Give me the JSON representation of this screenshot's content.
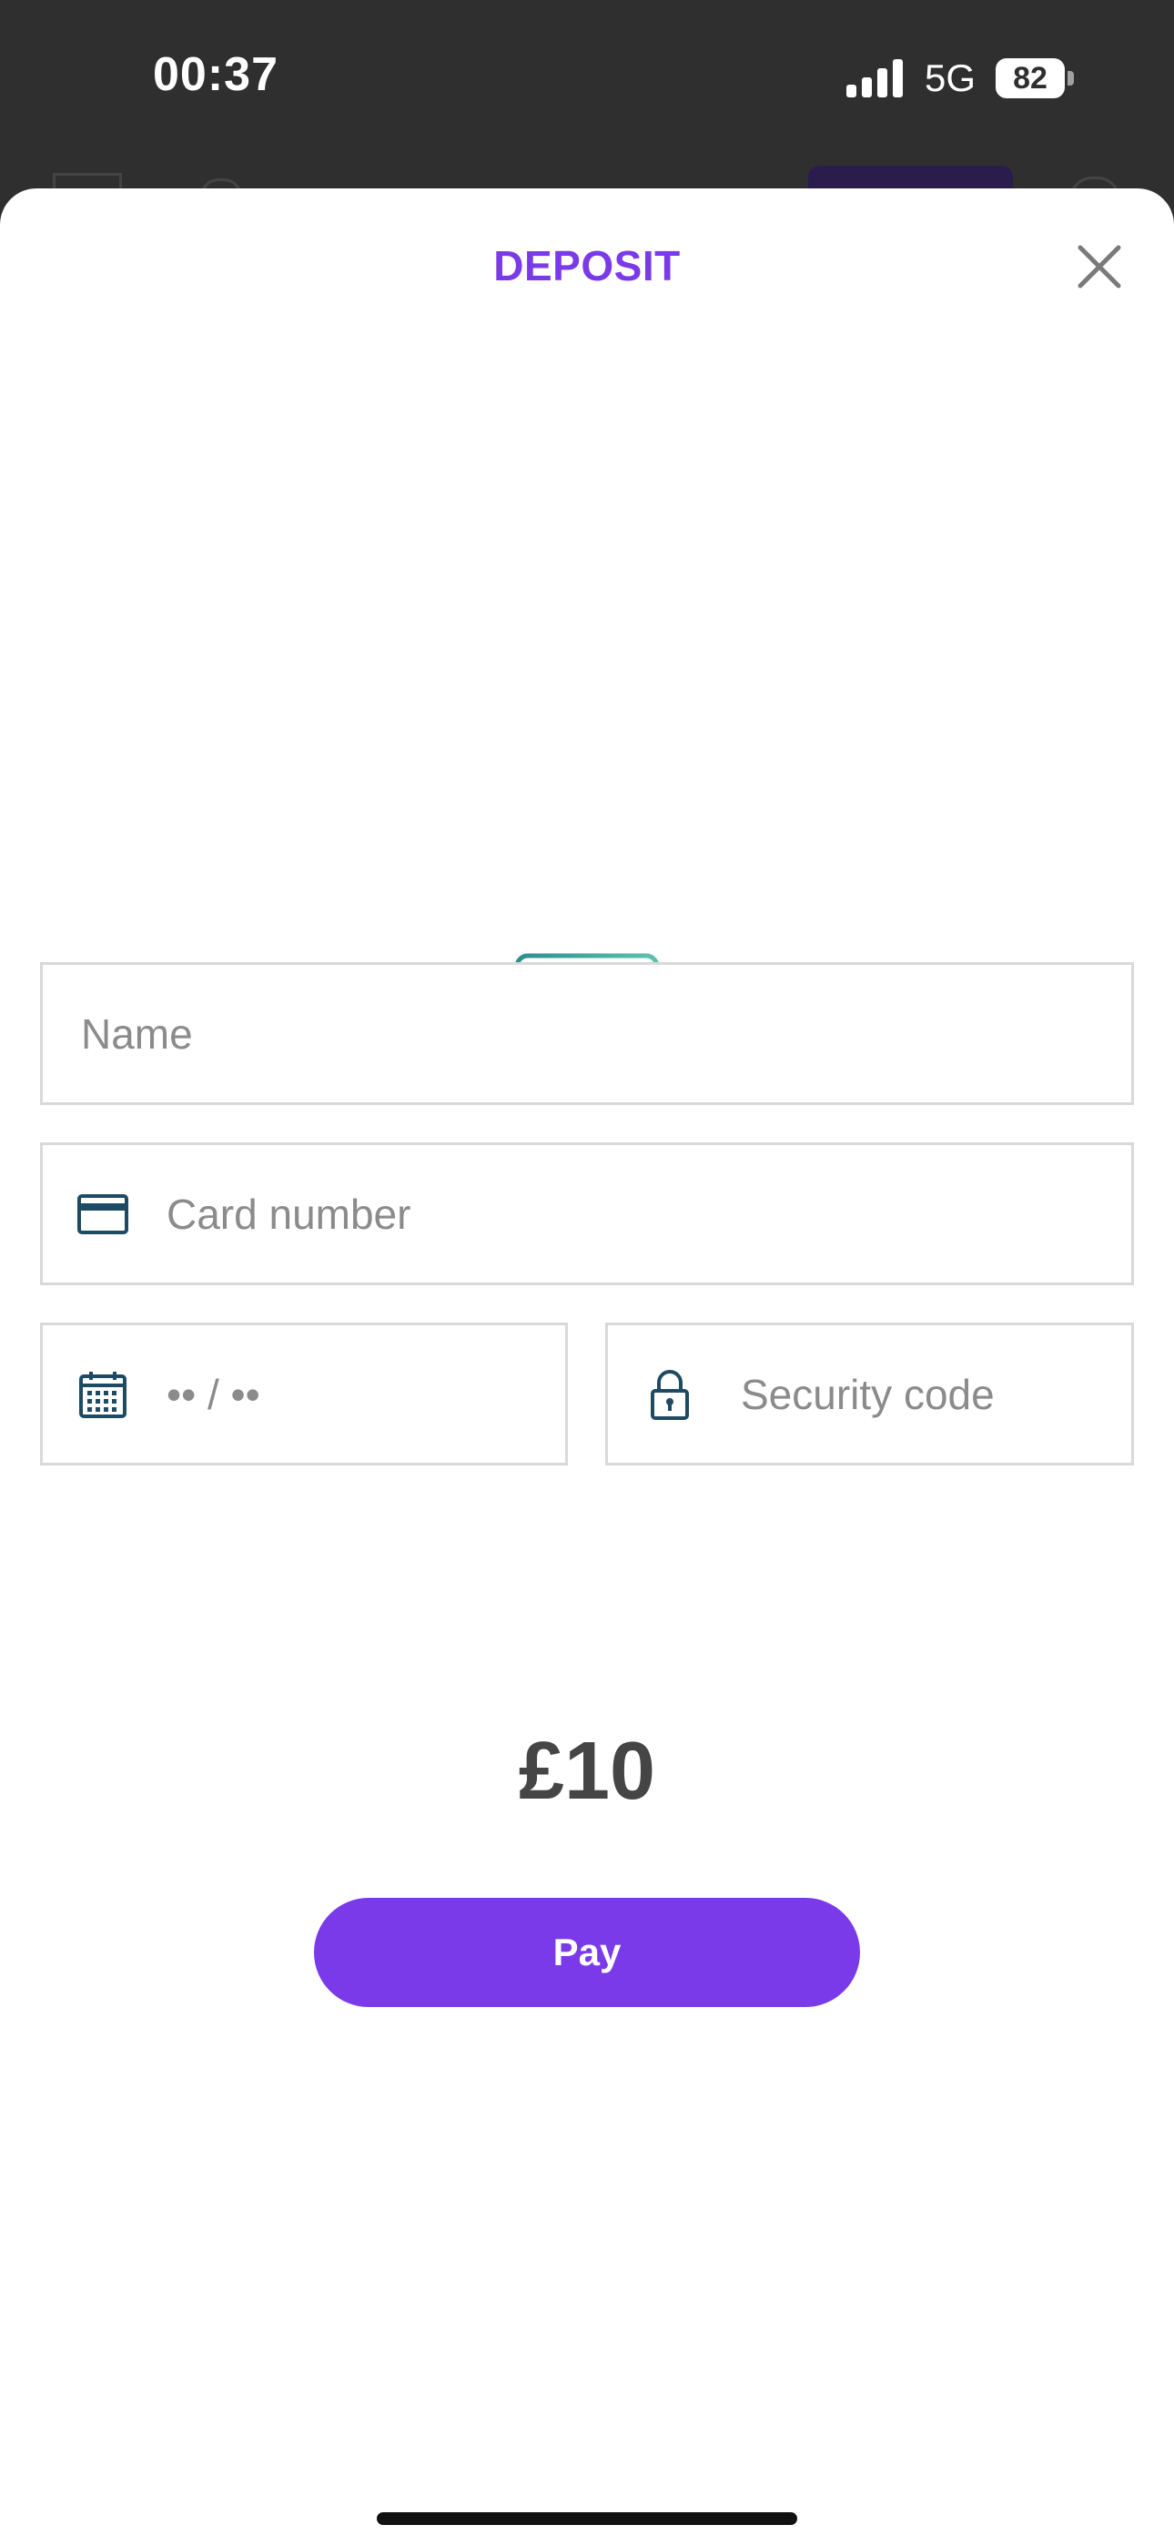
{
  "status_bar": {
    "time": "00:37",
    "network": "5G",
    "battery": "82"
  },
  "modal": {
    "title": "DEPOSIT"
  },
  "form": {
    "name_placeholder": "Name",
    "card_number_placeholder": "Card number",
    "expiry_placeholder": "•• / ••",
    "security_code_placeholder": "Security code"
  },
  "amount": "£10",
  "pay_label": "Pay",
  "colors": {
    "accent": "#7a3aea",
    "card_illustration": "#3aa39b",
    "field_icon": "#1f4a63"
  }
}
